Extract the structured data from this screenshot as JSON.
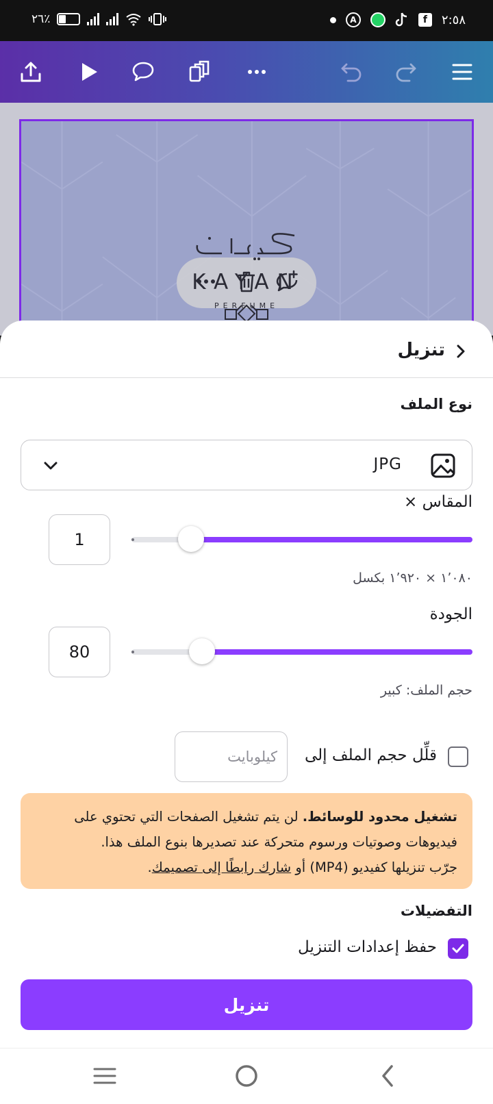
{
  "status_bar": {
    "time": "٢:٥٨",
    "battery": "٢٦٪"
  },
  "toolbar": {
    "icons": [
      "share-icon",
      "play-icon",
      "comment-icon",
      "pages-icon",
      "more-icon",
      "undo-icon",
      "redo-icon",
      "menu-icon"
    ]
  },
  "canvas": {
    "logo_arabic": "كيان",
    "logo_name": "KAYAN",
    "logo_subtitle": "PERFUME",
    "float_menu": [
      "more-icon",
      "trash-icon",
      "add-comment-icon"
    ]
  },
  "sheet": {
    "title": "تنزيل",
    "file_type": {
      "label": "نوع الملف",
      "value": "JPG"
    },
    "scale": {
      "label": "المقاس ×",
      "value": "1",
      "fraction": 0.826,
      "dimensions": "١٬٠٨٠ × ١٬٩٢٠ بكسل"
    },
    "quality": {
      "label": "الجودة",
      "value": "80",
      "fraction": 0.793,
      "file_size": "حجم الملف: كبير"
    },
    "reduce_size": {
      "label": "قلِّل حجم الملف إلى",
      "placeholder": "كيلوبايت",
      "checked": false
    },
    "notice": {
      "bold": "تشغيل محدود للوسائط.",
      "text": " لن يتم تشغيل الصفحات التي تحتوي على فيديوهات وصوتيات ورسوم متحركة عند تصديرها بنوع الملف هذا.",
      "line3_prefix": "جرّب تنزيلها كفيديو (MP4) أو ",
      "link": "شارك رابطًا إلى تصميمك",
      "line3_suffix": "."
    },
    "preferences": {
      "label": "التفضيلات",
      "save_settings": "حفظ إعدادات التنزيل",
      "checked": true
    },
    "download_button": "تنزيل"
  },
  "colors": {
    "accent": "#8b3dff",
    "notice_bg": "#fed2a4"
  }
}
